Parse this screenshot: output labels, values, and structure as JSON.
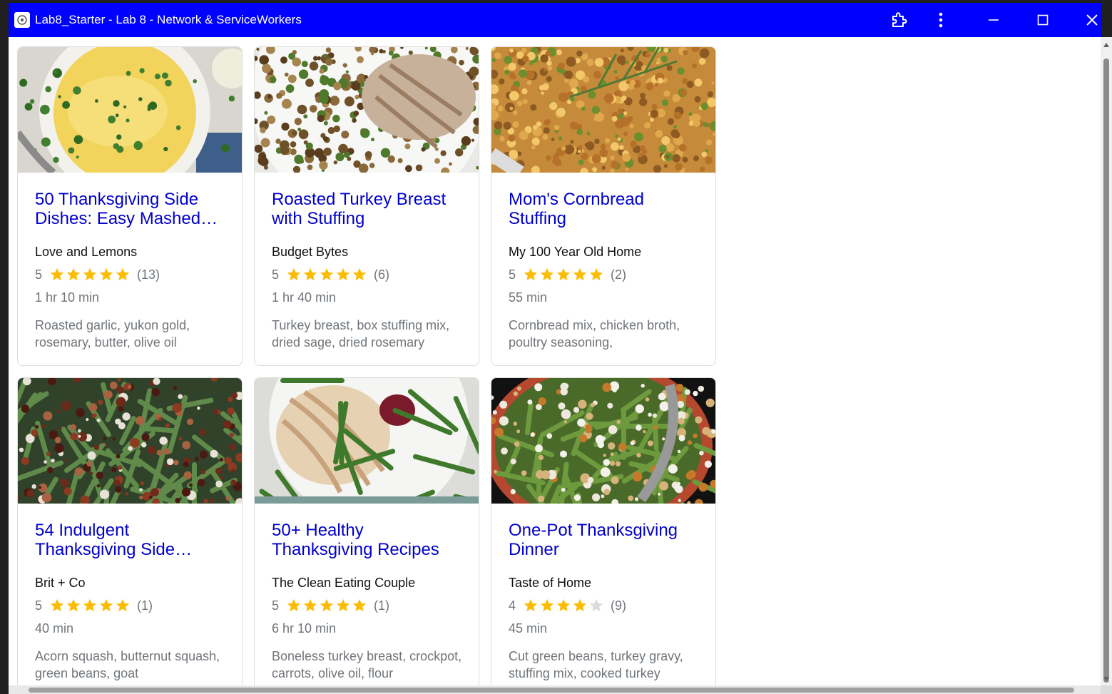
{
  "window": {
    "title": "Lab8_Starter - Lab 8 - Network & ServiceWorkers",
    "titlebar_color": "#0000ff",
    "icons": [
      "app-icon",
      "extensions-icon",
      "more-vert-icon",
      "minimize-icon",
      "maximize-icon",
      "close-icon"
    ]
  },
  "colors": {
    "link": "#0000cc",
    "star": "#fbbc04",
    "star_empty": "#dadce0",
    "meta": "#70757a"
  },
  "recipes": [
    {
      "title": "50 Thanksgiving Side Dishes: Easy Mashed…",
      "organization": "Love and Lemons",
      "rating": "5",
      "stars": 5,
      "reviews": "(13)",
      "time": "1 hr 10 min",
      "ingredients": "Roasted garlic, yukon gold, rosemary, butter, olive oil",
      "image": "mashed-potatoes"
    },
    {
      "title": "Roasted Turkey Breast with Stuffing",
      "organization": "Budget Bytes",
      "rating": "5",
      "stars": 5,
      "reviews": "(6)",
      "time": "1 hr 40 min",
      "ingredients": "Turkey breast, box stuffing mix, dried sage, dried rosemary",
      "image": "turkey-stuffing"
    },
    {
      "title": "Mom's Cornbread Stuffing",
      "organization": "My 100 Year Old Home",
      "rating": "5",
      "stars": 5,
      "reviews": "(2)",
      "time": "55 min",
      "ingredients": "Cornbread mix, chicken broth, poultry seasoning,",
      "image": "cornbread-stuffing"
    },
    {
      "title": "54 Indulgent Thanksgiving Side…",
      "organization": "Brit + Co",
      "rating": "5",
      "stars": 5,
      "reviews": "(1)",
      "time": "40 min",
      "ingredients": "Acorn squash, butternut squash, green beans, goat",
      "image": "green-beans-pecans"
    },
    {
      "title": "50+ Healthy Thanksgiving Recipes",
      "organization": "The Clean Eating Couple",
      "rating": "5",
      "stars": 5,
      "reviews": "(1)",
      "time": "6 hr 10 min",
      "ingredients": "Boneless turkey breast, crockpot, carrots, olive oil, flour",
      "image": "turkey-plate"
    },
    {
      "title": "One-Pot Thanksgiving Dinner",
      "organization": "Taste of Home",
      "rating": "4",
      "stars": 4,
      "reviews": "(9)",
      "time": "45 min",
      "ingredients": "Cut green beans, turkey gravy, stuffing mix, cooked turkey",
      "image": "one-pot-dinner"
    }
  ]
}
